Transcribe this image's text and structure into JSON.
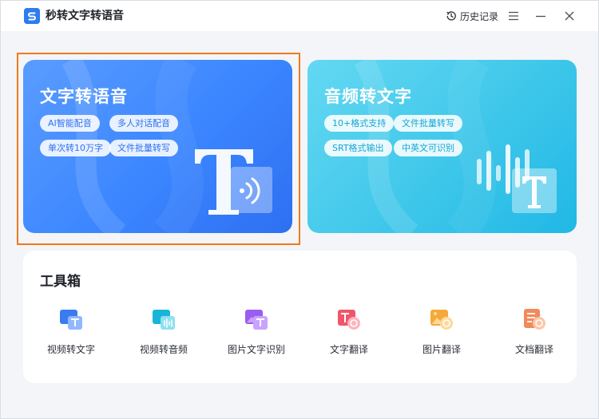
{
  "app": {
    "title": "秒转文字转语音"
  },
  "titlebar": {
    "history_label": "历史记录"
  },
  "cards": {
    "tts": {
      "title": "文字转语音",
      "chips": [
        "AI智能配音",
        "多人对话配音",
        "单次转10万字",
        "文件批量转写"
      ]
    },
    "stt": {
      "title": "音频转文字",
      "chips": [
        "10+格式支持",
        "文件批量转写",
        "SRT格式输出",
        "中英文可识别"
      ]
    }
  },
  "toolbox": {
    "title": "工具箱",
    "tools": [
      {
        "label": "视频转文字",
        "icon": "video-to-text-icon",
        "color": "#3a7bf0"
      },
      {
        "label": "视频转音频",
        "icon": "video-to-audio-icon",
        "color": "#19b5d8"
      },
      {
        "label": "图片文字识别",
        "icon": "image-ocr-icon",
        "color": "#9b5cf0"
      },
      {
        "label": "文字翻译",
        "icon": "text-translate-icon",
        "color": "#f0566a"
      },
      {
        "label": "图片翻译",
        "icon": "image-translate-icon",
        "color": "#f5a93a"
      },
      {
        "label": "文档翻译",
        "icon": "document-translate-icon",
        "color": "#f28a5a"
      }
    ]
  },
  "colors": {
    "accent": "#2d7cf0",
    "highlight_border": "#f07a1c",
    "tts_card": "#3b86ff",
    "stt_card": "#3fc7ea"
  }
}
